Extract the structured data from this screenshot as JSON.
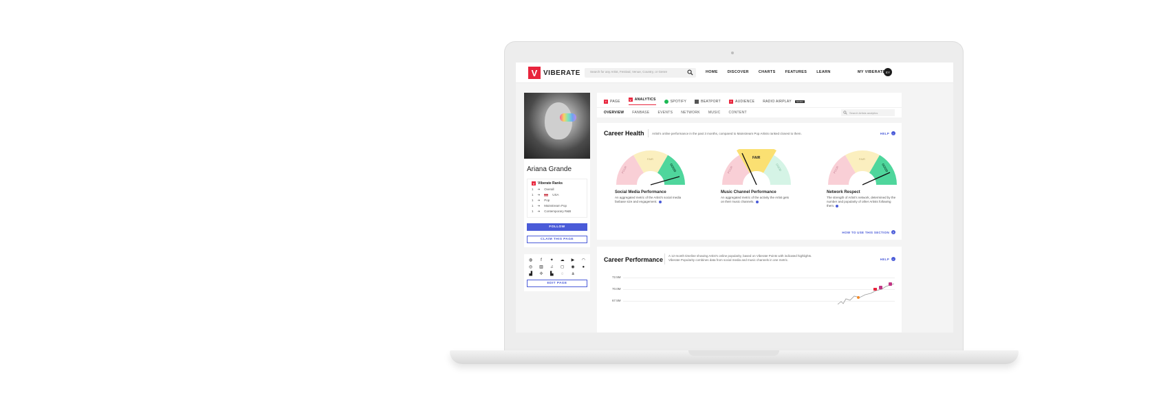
{
  "header": {
    "logo_letter": "V",
    "brand": "VIBERATE",
    "search_placeholder": "Search for any Artist, Festival, Venue, Country, or Genre",
    "nav": [
      "HOME",
      "DISCOVER",
      "CHARTS",
      "FEATURES",
      "LEARN"
    ],
    "my_viberate": "MY VIBERATE",
    "avatar_initials": "EY"
  },
  "artist": {
    "name": "Ariana Grande",
    "ranks_title": "Viberate Ranks",
    "ranks": [
      {
        "pos": "1",
        "arrow": "➔",
        "label": "Overall"
      },
      {
        "pos": "1",
        "arrow": "➔",
        "label": "USA"
      },
      {
        "pos": "1",
        "arrow": "➔",
        "label": "Pop"
      },
      {
        "pos": "1",
        "arrow": "➔",
        "label": "Mainstream Pop"
      },
      {
        "pos": "1",
        "arrow": "➔",
        "label": "Contemporary R&B"
      }
    ],
    "follow": "FOLLOW",
    "claim": "CLAIM THIS PAGE",
    "edit": "EDIT PAGE"
  },
  "tabs": [
    {
      "label": "PAGE",
      "icon_color": "#e8243c"
    },
    {
      "label": "ANALYTICS",
      "icon_color": "#e8243c"
    },
    {
      "label": "SPOTIFY",
      "icon_color": "#1db954"
    },
    {
      "label": "BEATPORT",
      "icon_color": "#555555"
    },
    {
      "label": "AUDIENCE",
      "icon_color": "#e8243c"
    },
    {
      "label": "RADIO AIRPLAY",
      "icon_color": ""
    }
  ],
  "soon_badge": "SOON",
  "subtabs": [
    "OVERVIEW",
    "FANBASE",
    "EVENTS",
    "NETWORK",
    "MUSIC",
    "CONTENT"
  ],
  "analytics_search_placeholder": "Search Artists analytics",
  "career_health": {
    "title": "Career Health",
    "description": "Artist's online performance in the past 3 months, compared to Mainstream Pop Artists ranked closest to them.",
    "help": "HELP",
    "howto": "HOW TO USE THIS SECTION",
    "gauges": [
      {
        "title": "Social Media Performance",
        "description": "An aggregated metric of the Artist's social media fanbase size and engagement.",
        "labels": [
          "POOR",
          "FAIR",
          "GOOD"
        ],
        "rating": "GOOD"
      },
      {
        "title": "Music Channel Performance",
        "description": "An aggregated metric of the activity the Artist gets on their music channels.",
        "labels": [
          "POOR",
          "FAIR",
          "GOOD"
        ],
        "rating": "FAIR"
      },
      {
        "title": "Network Respect",
        "description": "The strength of Artist's network, determined by the number and popularity of other Artists following them.",
        "labels": [
          "POOR",
          "FAIR",
          "GOOD"
        ],
        "rating": "GOOD"
      }
    ]
  },
  "career_performance": {
    "title": "Career Performance",
    "description": "A 12-month timeline showing Artist's online popularity, based on Viberate Points with indicated highlights. Viberate Popularity combines data from social media and music channels in one metric.",
    "help": "HELP",
    "y_ticks": [
      "72.5M",
      "70.0M",
      "67.5M"
    ]
  },
  "social_icons": [
    "globe-icon",
    "facebook-icon",
    "twitter-icon",
    "soundcloud-icon",
    "youtube-icon",
    "headphones-icon",
    "mixcloud-icon",
    "deezer-icon",
    "itunes-icon",
    "instagram-icon",
    "shazam-icon",
    "spotify-icon",
    "chart-icon",
    "tidal-icon",
    "bandsintown-icon",
    "songkick-icon",
    "amazon-icon",
    "blank"
  ],
  "colors": {
    "brand_red": "#e8243c",
    "accent_blue": "#4a5bd8",
    "poor": "#f9cfd6",
    "fair": "#fbe9a8",
    "good": "#4fd69c"
  }
}
